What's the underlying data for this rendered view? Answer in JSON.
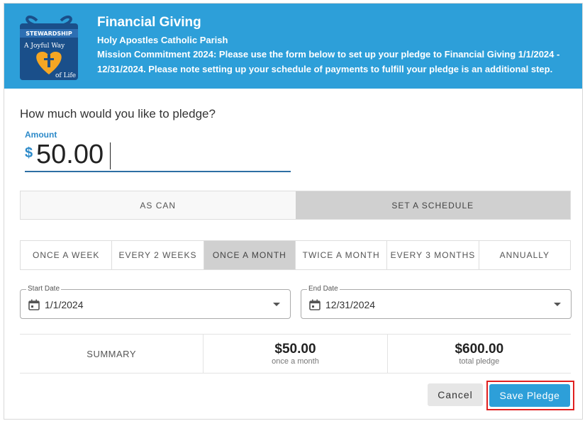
{
  "header": {
    "title": "Financial Giving",
    "parish": "Holy Apostles Catholic Parish",
    "description": "Mission Commitment 2024: Please use the form below to set up your pledge to Financial Giving 1/1/2024 - 12/31/2024. Please note setting up your schedule of payments to fulfill your pledge is an additional step.",
    "logo": {
      "top": "STEWARDSHIP",
      "line1": "A Joyful Way",
      "line2": "of Life"
    }
  },
  "pledge": {
    "question": "How much would you like to pledge?",
    "amount_label": "Amount",
    "currency": "$",
    "amount": "50.00"
  },
  "modes": [
    {
      "label": "AS CAN",
      "active": false
    },
    {
      "label": "SET A SCHEDULE",
      "active": true
    }
  ],
  "frequencies": [
    {
      "label": "ONCE A WEEK",
      "active": false
    },
    {
      "label": "EVERY 2 WEEKS",
      "active": false
    },
    {
      "label": "ONCE A MONTH",
      "active": true
    },
    {
      "label": "TWICE A MONTH",
      "active": false
    },
    {
      "label": "EVERY 3 MONTHS",
      "active": false
    },
    {
      "label": "ANNUALLY",
      "active": false
    }
  ],
  "dates": {
    "start_label": "Start Date",
    "start_value": "1/1/2024",
    "end_label": "End Date",
    "end_value": "12/31/2024"
  },
  "summary": {
    "label": "SUMMARY",
    "per_payment": "$50.00",
    "per_payment_sub": "once a month",
    "total": "$600.00",
    "total_sub": "total pledge"
  },
  "actions": {
    "cancel": "Cancel",
    "save": "Save Pledge"
  },
  "colors": {
    "brand": "#2d9fd9",
    "highlight": "#e02020",
    "active_tab": "#d0d0d0"
  }
}
